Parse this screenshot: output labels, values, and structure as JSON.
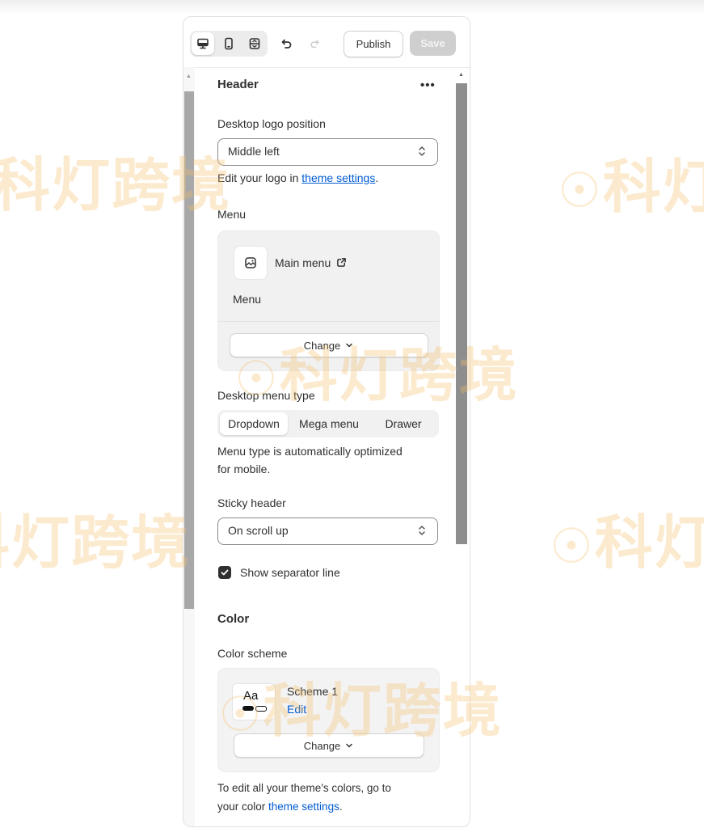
{
  "toolbar": {
    "device_icons": [
      "desktop-icon",
      "mobile-icon",
      "fullscreen-icon"
    ],
    "undo_icon": "undo-icon",
    "redo_icon": "redo-icon",
    "publish_label": "Publish",
    "save_label": "Save"
  },
  "section": {
    "title": "Header",
    "more_label": "•••"
  },
  "logo_position": {
    "label": "Desktop logo position",
    "value": "Middle left",
    "help_prefix": "Edit your logo in ",
    "help_link": "theme settings",
    "help_suffix": "."
  },
  "menu": {
    "label": "Menu",
    "menu_name": "Main menu",
    "sub_label": "Menu",
    "change_label": "Change"
  },
  "menu_type": {
    "label": "Desktop menu type",
    "options": [
      "Dropdown",
      "Mega menu",
      "Drawer"
    ],
    "selected": "Dropdown",
    "help_line1": "Menu type is automatically optimized",
    "help_line2": "for mobile."
  },
  "sticky": {
    "label": "Sticky header",
    "value": "On scroll up"
  },
  "separator": {
    "label": "Show separator line",
    "checked": true
  },
  "color": {
    "heading": "Color",
    "scheme_label": "Color scheme",
    "swatch_text": "Aa",
    "scheme_name": "Scheme 1",
    "edit_label": "Edit",
    "change_label": "Change",
    "help_line1": "To edit all your theme's colors, go to",
    "help_prefix2": "your color ",
    "help_link": "theme settings",
    "help_suffix": "."
  },
  "watermark": {
    "text_a": "科灯跨境",
    "text_b": "科灯",
    "text_c": "科灯跨境"
  }
}
